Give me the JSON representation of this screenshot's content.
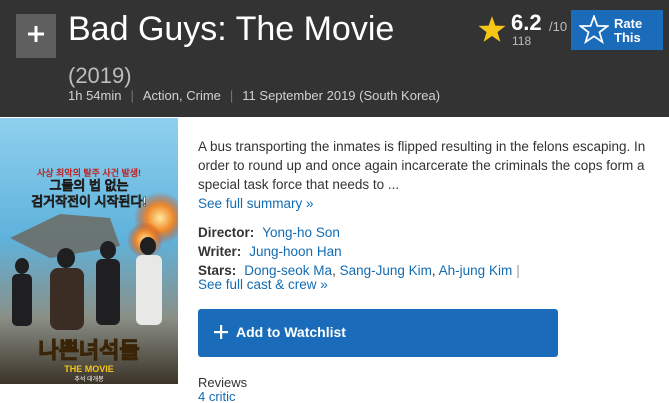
{
  "header": {
    "title": "Bad Guys: The Movie",
    "year": "(2019)",
    "runtime": "1h 54min",
    "genres": "Action, Crime",
    "release": "11 September 2019 (South Korea)"
  },
  "rating": {
    "score": "6.2",
    "out_of": "/10",
    "votes": "118",
    "rate_label": "Rate This"
  },
  "poster": {
    "tagline_1": "사상 최악의 탈주 사건 발생!",
    "tagline_2": "그들의 법 없는",
    "tagline_3": "검거작전이 시작된다!",
    "title_ko": "나쁜녀석들",
    "title_en": "THE MOVIE",
    "footer": "추석 대개봉"
  },
  "summary": {
    "text": "A bus transporting the inmates is flipped resulting in the felons escaping. In order to round up and once again incarcerate the criminals the cops form a special task force that needs to ...",
    "link": "See full summary »"
  },
  "credits": {
    "director_label": "Director:",
    "director": "Yong-ho Son",
    "writer_label": "Writer:",
    "writer": "Jung-hoon Han",
    "stars_label": "Stars:",
    "stars": [
      "Dong-seok Ma",
      "Sang-Jung Kim",
      "Ah-jung Kim"
    ],
    "full_cast_link": "See full cast & crew »"
  },
  "watchlist": {
    "label": "Add to Watchlist"
  },
  "reviews": {
    "label": "Reviews",
    "critic": "4 critic"
  },
  "colors": {
    "accent_blue": "#1a6cba",
    "link_blue": "#136cb2",
    "star_yellow": "#f5c518",
    "hero_bg": "#333333"
  }
}
